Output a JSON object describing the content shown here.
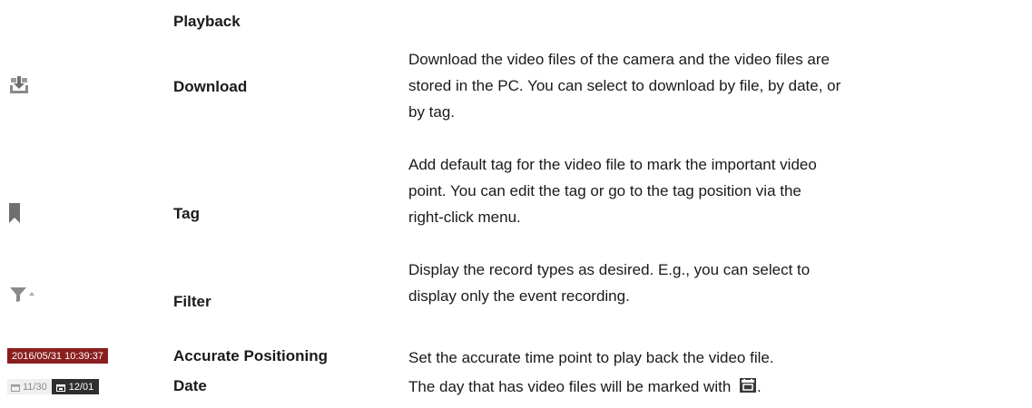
{
  "heading": "Playback",
  "rows": [
    {
      "icon": "download-icon",
      "name": "Download",
      "desc_lines": [
        "Download the video files of the camera and the video files are",
        "stored in the PC. You can select to download by file, by date, or",
        "by tag."
      ]
    },
    {
      "icon": "tag-icon",
      "name": "Tag",
      "desc_lines": [
        "Add default tag for the video file to mark the important video",
        "point. You can edit the tag or go to the tag position via the",
        "right-click menu."
      ]
    },
    {
      "icon": "filter-icon",
      "name": "Filter",
      "desc_lines": [
        "Display the record types as desired. E.g., you can select to",
        "display only the event recording."
      ]
    },
    {
      "icon": "time-display",
      "icon_text": "2016/05/31 10:39:37",
      "name": "Accurate Positioning",
      "desc_lines": [
        "Set the accurate time point to play back the video file."
      ]
    },
    {
      "icon": "date-selector",
      "icon_text_a": "11/30",
      "icon_text_b": "12/01",
      "name": "Date",
      "desc_lines": [
        "The day that has video files will be marked with"
      ],
      "desc_suffix": ".",
      "inline_icon": "calendar-icon"
    }
  ],
  "colors": {
    "time_bg": "#8b1e1e",
    "date_dark_bg": "#2f2f2f",
    "icon_gray": "#8a8a8a"
  }
}
